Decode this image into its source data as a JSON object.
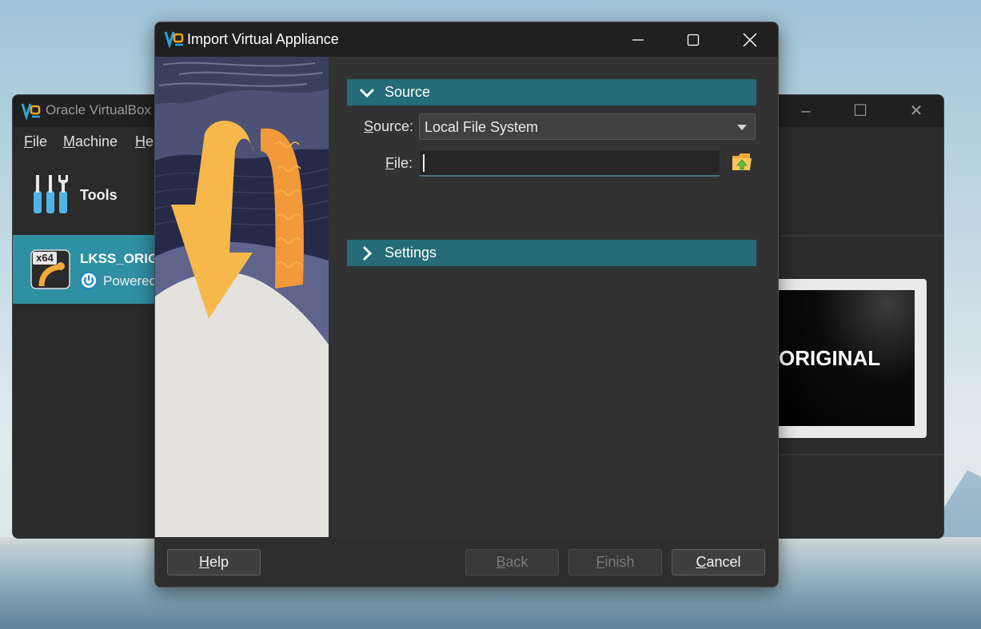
{
  "main_window": {
    "title": "Oracle VirtualBox",
    "menu": [
      {
        "label_first": "F",
        "label_rest": "ile"
      },
      {
        "label_first": "M",
        "label_rest": "achine"
      },
      {
        "label_first": "H",
        "label_rest": "el"
      }
    ],
    "tools_label": "Tools",
    "vm": {
      "name": "LKSS_ORIGINAL",
      "state": "Powered",
      "os_badge": "x64"
    },
    "preview_text": "ORIGINAL",
    "controls": {
      "minimize": "–",
      "maximize": "☐",
      "close": "✕"
    }
  },
  "dialog": {
    "title": "Import Virtual Appliance",
    "sections": {
      "source": {
        "label": "Source",
        "expanded": true
      },
      "settings": {
        "label": "Settings",
        "expanded": false
      }
    },
    "source_field": {
      "label_first": "S",
      "label_rest": "ource:",
      "value": "Local File System"
    },
    "file_field": {
      "label_first": "F",
      "label_rest": "ile:",
      "value": "",
      "placeholder": ""
    },
    "buttons": {
      "help": {
        "first": "H",
        "rest": "elp",
        "enabled": true
      },
      "back": {
        "first": "B",
        "rest": "ack",
        "enabled": false
      },
      "finish": {
        "first": "F",
        "rest": "inish",
        "enabled": false
      },
      "cancel": {
        "first": "C",
        "rest": "ancel",
        "enabled": true
      }
    }
  },
  "colors": {
    "section_header": "#256b78",
    "selected_vm_row": "#2f8fa3",
    "dialog_background": "#323232",
    "titlebar": "#202020"
  },
  "icons": [
    "virtualbox-logo-icon",
    "minimize-icon",
    "maximize-icon",
    "close-icon",
    "chevron-down-icon",
    "chevron-right-icon",
    "folder-open-icon",
    "tools-icon",
    "power-icon",
    "os-x64-icon"
  ]
}
